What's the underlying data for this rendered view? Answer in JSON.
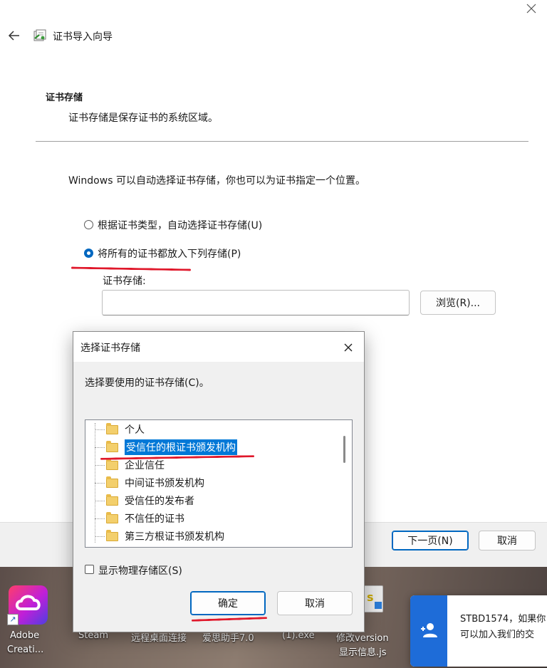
{
  "wizard": {
    "title": "证书导入向导",
    "section_heading": "证书存储",
    "section_desc": "证书存储是保存证书的系统区域。",
    "intro": "Windows 可以自动选择证书存储，你也可以为证书指定一个位置。",
    "option_auto": "根据证书类型，自动选择证书存储(U)",
    "option_manual": "将所有的证书都放入下列存储(P)",
    "option_manual_selected": true,
    "store_label": "证书存储:",
    "store_value": "",
    "browse_label": "浏览(R)...",
    "next_label": "下一页(N)",
    "cancel_label": "取消"
  },
  "dialog": {
    "title": "选择证书存储",
    "prompt": "选择要使用的证书存储(C)。",
    "stores": [
      "个人",
      "受信任的根证书颁发机构",
      "企业信任",
      "中间证书颁发机构",
      "受信任的发布者",
      "不信任的证书",
      "第三方根证书颁发机构"
    ],
    "selected_index": 1,
    "show_physical_label": "显示物理存储区(S)",
    "show_physical_checked": false,
    "ok_label": "确定",
    "cancel_label": "取消"
  },
  "desktop": {
    "icons": [
      {
        "label_line1": "Adobe",
        "label_line2": "Creati..."
      },
      {
        "label_line1": "Steam",
        "label_line2": ""
      },
      {
        "label_line1": "远程桌面连接",
        "label_line2": ""
      },
      {
        "label_line1": "爱思助手7.0",
        "label_line2": ""
      },
      {
        "label_line1": "(1).exe",
        "label_line2": ""
      },
      {
        "label_line1": "修改version",
        "label_line2": "显示信息.js"
      }
    ]
  },
  "notification": {
    "line1": "STBD1574，如果你",
    "line2": "可以加入我们的交"
  },
  "colors": {
    "accent": "#0067c0",
    "annotation": "#e0182b",
    "selection": "#0078d7"
  }
}
